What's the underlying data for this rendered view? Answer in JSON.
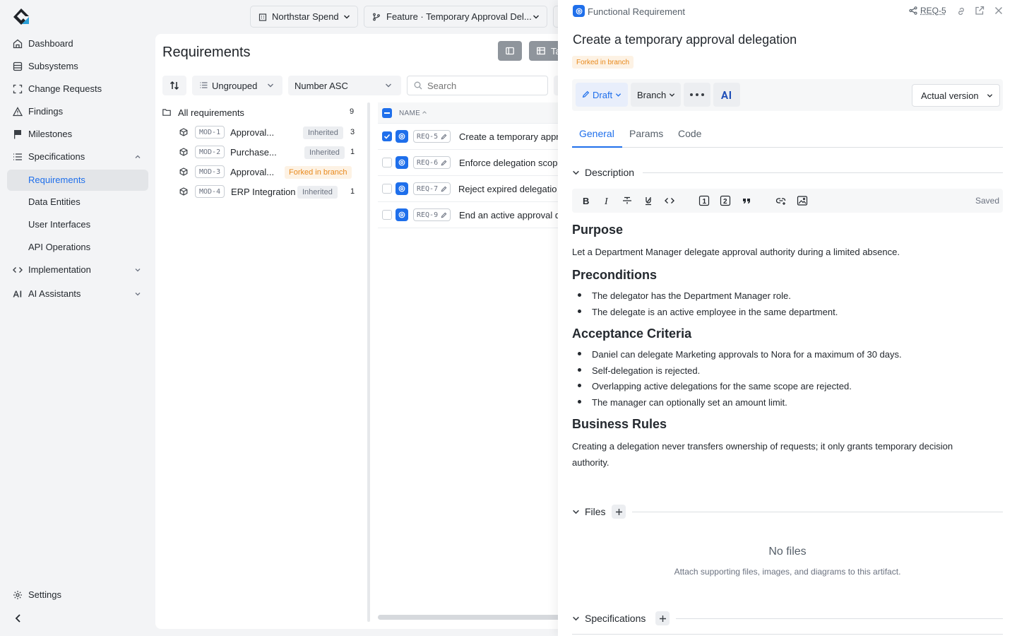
{
  "topbar": {
    "workspace": "Northstar Spend",
    "branch": "Feature · Temporary Approval Del..."
  },
  "sidebar": {
    "items": [
      {
        "label": "Dashboard",
        "icon": "dashboard-icon"
      },
      {
        "label": "Subsystems",
        "icon": "subsystems-icon"
      },
      {
        "label": "Change Requests",
        "icon": "change-requests-icon"
      },
      {
        "label": "Findings",
        "icon": "warning-icon"
      },
      {
        "label": "Milestones",
        "icon": "flag-icon"
      },
      {
        "label": "Specifications",
        "icon": "list-icon"
      },
      {
        "label": "Requirements"
      },
      {
        "label": "Data Entities"
      },
      {
        "label": "User Interfaces"
      },
      {
        "label": "API Operations"
      },
      {
        "label": "Implementation",
        "icon": "code-icon"
      },
      {
        "label": "AI Assistants",
        "icon": "ai-icon"
      }
    ],
    "settings": "Settings"
  },
  "main": {
    "title": "Requirements",
    "table_view_partial": "Ta",
    "group_select": "Ungrouped",
    "sort_select": "Number ASC",
    "search_placeholder": "Search",
    "tree": {
      "root": {
        "label": "All requirements",
        "count": "9"
      },
      "modules": [
        {
          "code": "MOD-1",
          "name": "Approval...",
          "tag": "Inherited",
          "count": "3"
        },
        {
          "code": "MOD-2",
          "name": "Purchase...",
          "tag": "Inherited",
          "count": "1"
        },
        {
          "code": "MOD-3",
          "name": "Approval...",
          "tag": "Forked in branch",
          "count": ""
        },
        {
          "code": "MOD-4",
          "name": "ERP Integration",
          "tag": "Inherited",
          "count": "1"
        }
      ]
    },
    "table": {
      "col_name": "NAME",
      "rows": [
        {
          "code": "REQ-5",
          "name": "Create a temporary appro",
          "checked": true
        },
        {
          "code": "REQ-6",
          "name": "Enforce delegation scope",
          "checked": false
        },
        {
          "code": "REQ-7",
          "name": "Reject expired delegatio",
          "checked": false
        },
        {
          "code": "REQ-9",
          "name": "End an active approval de",
          "checked": false
        }
      ]
    }
  },
  "drawer": {
    "type_label": "Functional Requirement",
    "ref": "REQ-5",
    "title": "Create a temporary approval delegation",
    "fork_badge": "Forked in branch",
    "status": "Draft",
    "branch_btn": "Branch",
    "ai_btn": "AI",
    "version_select": "Actual version",
    "tabs": [
      "General",
      "Params",
      "Code"
    ],
    "description_label": "Description",
    "saved_label": "Saved",
    "content": {
      "purpose_h": "Purpose",
      "purpose_p": "Let a Department Manager delegate approval authority during a limited absence.",
      "pre_h": "Preconditions",
      "pre_items": [
        "The delegator has the Department Manager role.",
        "The delegate is an active employee in the same department."
      ],
      "ac_h": "Acceptance Criteria",
      "ac_items": [
        "Daniel can delegate Marketing approvals to Nora for a maximum of 30 days.",
        "Self-delegation is rejected.",
        "Overlapping active delegations for the same scope are rejected.",
        "The manager can optionally set an amount limit."
      ],
      "br_h": "Business Rules",
      "br_p1": "Creating a delegation never transfers ownership of requests; it only grants temporary decision",
      "br_p2": "authority."
    },
    "files_label": "Files",
    "no_files": "No files",
    "no_files_hint": "Attach supporting files, images, and diagrams to this artifact.",
    "specs_label": "Specifications"
  },
  "colors": {
    "accent": "#1f6feb",
    "fork": "#e8891c"
  }
}
